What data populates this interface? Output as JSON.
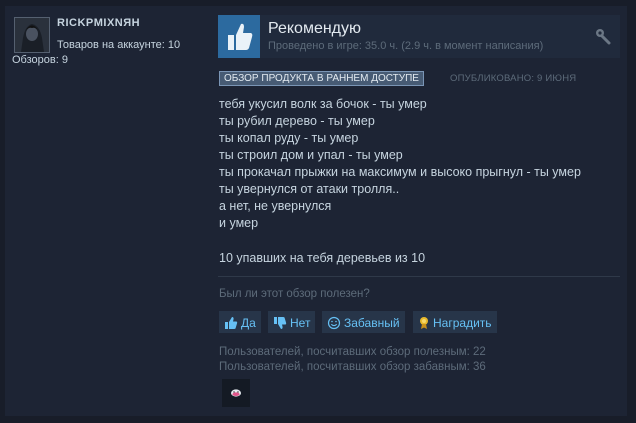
{
  "author": {
    "username": "RICKPMIXNЯH",
    "products_owned": "Товаров на аккаунте: 10",
    "reviews_count": "Обзоров: 9"
  },
  "review": {
    "verdict": "Рекомендую",
    "hours": "Проведено в игре: 35.0 ч. (2.9 ч. в момент написания)",
    "early_access_badge": "ОБЗОР ПРОДУКТА В РАННЕМ ДОСТУПЕ",
    "posted": "ОПУБЛИКОВАНО: 9 ИЮНЯ",
    "lines": [
      "тебя укусил волк за бочок - ты умер",
      "ты рубил дерево - ты умер",
      "ты копал руду - ты умер",
      "ты строил дом и упал - ты умер",
      "ты прокачал прыжки на максимум и высоко прыгнул - ты умер",
      "ты увернулся от атаки тролля..",
      "а нет, не увернулся",
      "и умер",
      "",
      "10 упавших на тебя деревьев из 10"
    ]
  },
  "feedback": {
    "question": "Был ли этот обзор полезен?",
    "yes_label": "Да",
    "no_label": "Нет",
    "funny_label": "Забавный",
    "award_label": "Наградить",
    "helpful_count": "Пользователей, посчитавших обзор полезным: 22",
    "funny_count": "Пользователей, посчитавших обзор забавным: 36"
  },
  "icons": {
    "thumbs_up": "thumbs-up-icon",
    "thumbs_down": "thumbs-down-icon",
    "smiley": "smiley-icon",
    "award": "award-icon",
    "wrench": "wrench-icon"
  },
  "colors": {
    "accent": "#66c0f4",
    "thumb_bg": "#2c6a9f",
    "background": "#1d2434"
  }
}
